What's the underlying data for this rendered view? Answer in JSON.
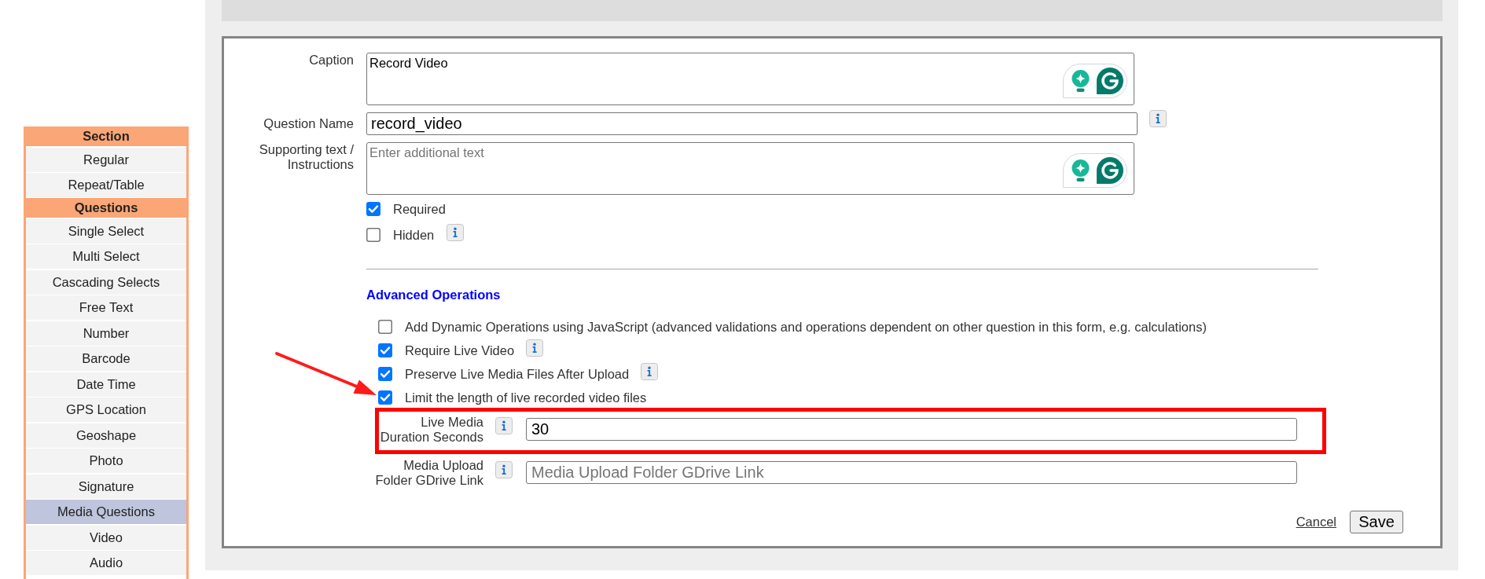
{
  "sidebar": {
    "groups": [
      {
        "title": "Section",
        "items": [
          {
            "label": "Regular",
            "selected": false
          },
          {
            "label": "Repeat/Table",
            "selected": false
          }
        ]
      },
      {
        "title": "Questions",
        "items": [
          {
            "label": "Single Select",
            "selected": false
          },
          {
            "label": "Multi Select",
            "selected": false
          },
          {
            "label": "Cascading Selects",
            "selected": false
          },
          {
            "label": "Free Text",
            "selected": false
          },
          {
            "label": "Number",
            "selected": false
          },
          {
            "label": "Barcode",
            "selected": false
          },
          {
            "label": "Date Time",
            "selected": false
          },
          {
            "label": "GPS Location",
            "selected": false
          },
          {
            "label": "Geoshape",
            "selected": false
          },
          {
            "label": "Photo",
            "selected": false
          },
          {
            "label": "Signature",
            "selected": false
          },
          {
            "label": "Media Questions",
            "selected": true
          },
          {
            "label": "Video",
            "selected": false
          },
          {
            "label": "Audio",
            "selected": false
          }
        ]
      }
    ]
  },
  "form": {
    "fields": [
      {
        "kind": "textarea",
        "label": "Caption",
        "value": "Record Video",
        "info": false
      },
      {
        "kind": "input",
        "label": "Question Name",
        "value": "record_video",
        "info": true
      },
      {
        "kind": "textarea",
        "label": "Supporting text / Instructions",
        "placeholder": "Enter additional text",
        "info": false
      }
    ],
    "options": [
      {
        "label": "Required",
        "checked": true,
        "info": false
      },
      {
        "label": "Hidden",
        "checked": false,
        "info": true
      }
    ],
    "advanced": {
      "title": "Advanced Operations",
      "options": [
        {
          "label": "Add Dynamic Operations using JavaScript (advanced validations and operations dependent on other question in this form, e.g. calculations)",
          "checked": false,
          "info": false,
          "pointed": false
        },
        {
          "label": "Require Live Video",
          "checked": true,
          "info": true,
          "pointed": false
        },
        {
          "label": "Preserve Live Media Files After Upload",
          "checked": true,
          "info": true,
          "pointed": false
        },
        {
          "label": "Limit the length of live recorded video files",
          "checked": true,
          "info": false,
          "pointed": true
        }
      ],
      "fields": [
        {
          "label": "Live Media Duration Seconds",
          "value": "30",
          "info": true,
          "highlighted": true
        },
        {
          "label": "Media Upload Folder GDrive Link",
          "placeholder": "Media Upload Folder GDrive Link",
          "info": true,
          "highlighted": false
        }
      ]
    },
    "actions": [
      {
        "kind": "link",
        "label": "Cancel"
      },
      {
        "kind": "button",
        "label": "Save"
      }
    ]
  }
}
